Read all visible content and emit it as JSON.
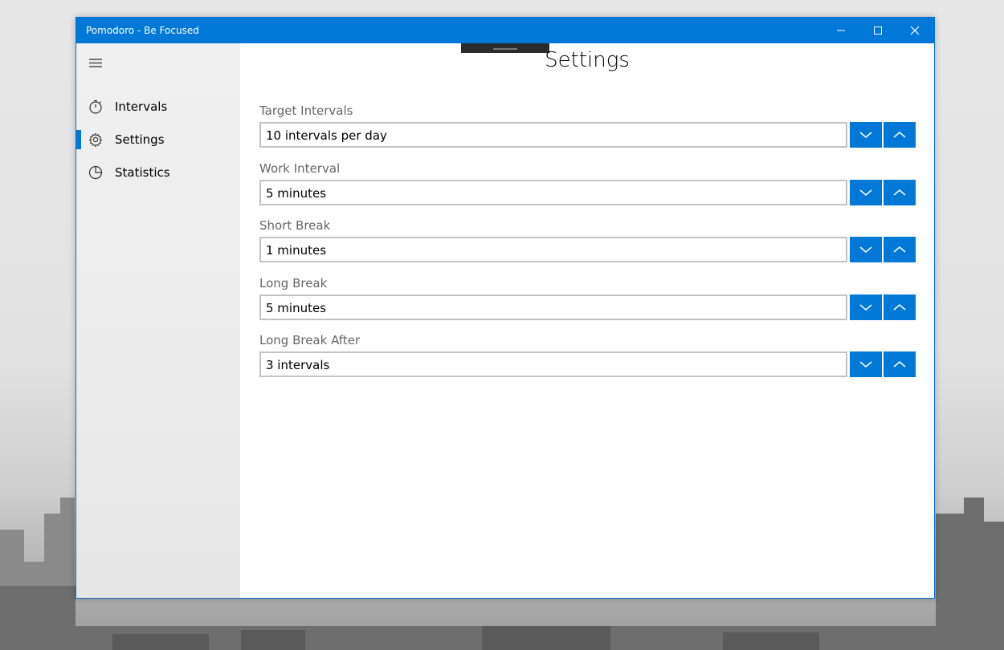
{
  "window": {
    "title": "Pomodoro - Be Focused",
    "accent_color": "#0078d7",
    "controls": [
      "minimize-icon",
      "maximize-icon",
      "close-icon"
    ]
  },
  "sidebar": {
    "menu_icon": "hamburger-icon",
    "items": [
      {
        "label": "Intervals",
        "icon": "stopwatch-icon",
        "selected": false
      },
      {
        "label": "Settings",
        "icon": "gear-icon",
        "selected": true
      },
      {
        "label": "Statistics",
        "icon": "pie-chart-icon",
        "selected": false
      }
    ]
  },
  "main": {
    "title": "Settings",
    "fields": [
      {
        "label": "Target Intervals",
        "value": "10 intervals per day"
      },
      {
        "label": "Work Interval",
        "value": "5 minutes"
      },
      {
        "label": "Short Break",
        "value": "1 minutes"
      },
      {
        "label": "Long Break",
        "value": "5 minutes"
      },
      {
        "label": "Long Break After",
        "value": "3 intervals"
      }
    ],
    "decrement_icon": "chevron-down-icon",
    "increment_icon": "chevron-up-icon"
  }
}
